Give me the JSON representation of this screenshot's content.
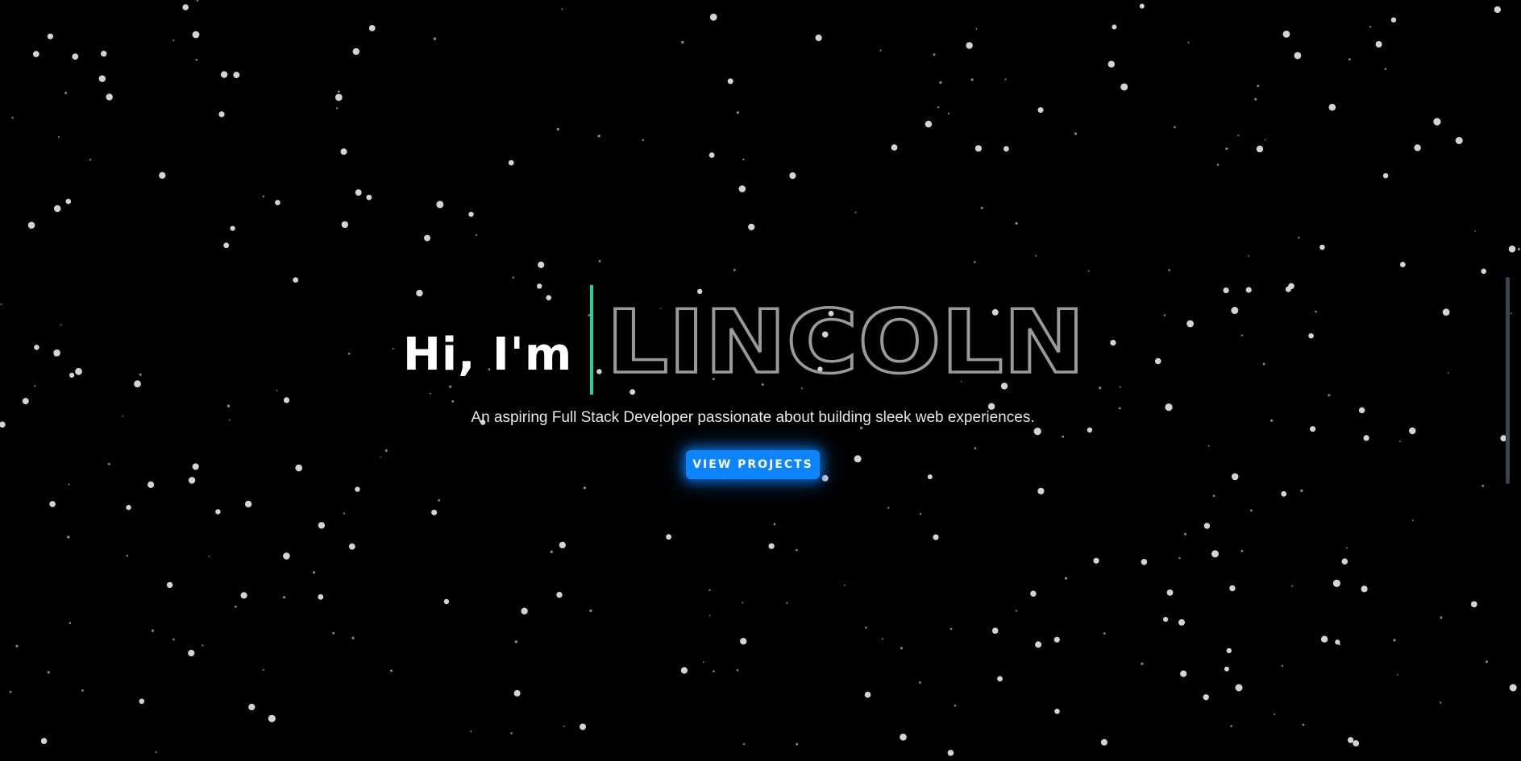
{
  "hero": {
    "greeting": "Hi, I'm",
    "name": "LINCOLN",
    "tagline": "An aspiring Full Stack Developer passionate about building sleek web experiences.",
    "cta_label": "VIEW PROJECTS"
  },
  "colors": {
    "background": "#000000",
    "accent_cursor": "#2ecc9a",
    "cta": "#0d84ff",
    "name_outline": "#9a9a9a",
    "star": "#d8d8d8"
  },
  "icons": {
    "cursor": "typing-cursor-bar"
  }
}
